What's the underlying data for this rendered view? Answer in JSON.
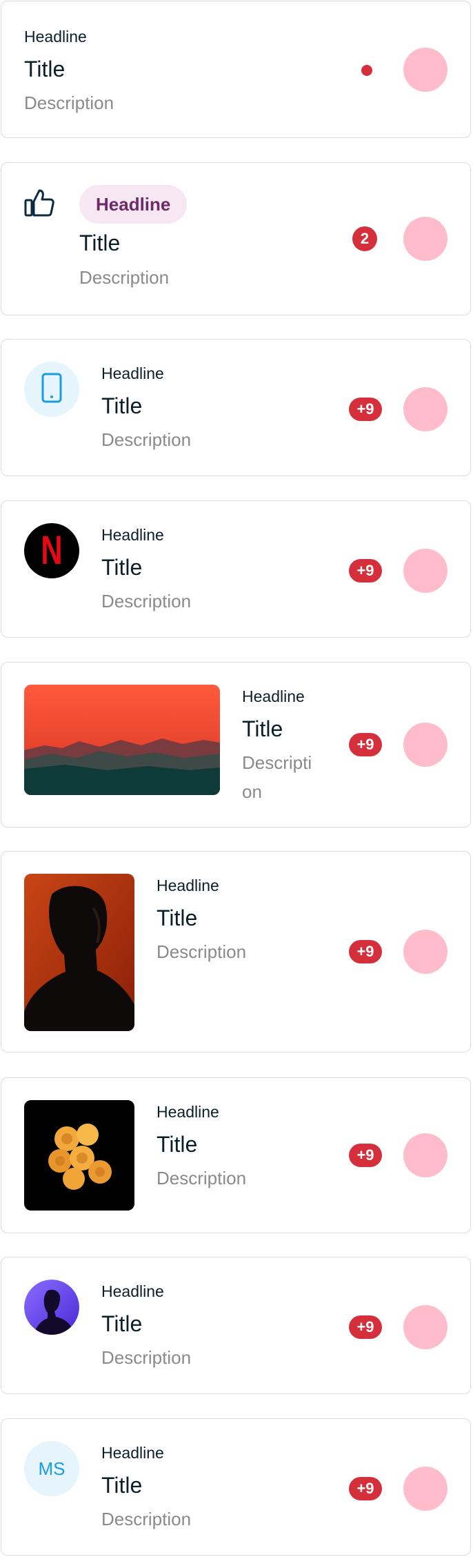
{
  "items": [
    {
      "headline": "Headline",
      "title": "Title",
      "description": "Description",
      "badge": ""
    },
    {
      "headline": "Headline",
      "title": "Title",
      "description": "Description",
      "badge": "2",
      "icon": "thumbs-up-icon"
    },
    {
      "headline": "Headline",
      "title": "Title",
      "description": "Description",
      "badge": "+9",
      "icon": "smartphone-icon"
    },
    {
      "headline": "Headline",
      "title": "Title",
      "description": "Description",
      "badge": "+9",
      "logo": "N"
    },
    {
      "headline": "Headline",
      "title": "Title",
      "description_line1": "Descripti",
      "description_line2": "on",
      "badge": "+9"
    },
    {
      "headline": "Headline",
      "title": "Title",
      "description": "Description",
      "badge": "+9"
    },
    {
      "headline": "Headline",
      "title": "Title",
      "description": "Description",
      "badge": "+9"
    },
    {
      "headline": "Headline",
      "title": "Title",
      "description": "Description",
      "badge": "+9"
    },
    {
      "headline": "Headline",
      "title": "Title",
      "description": "Description",
      "badge": "+9",
      "initials": "MS"
    }
  ],
  "colors": {
    "badge": "#d52f3c",
    "action": "#ffbdcc",
    "chip_bg": "#f6e7f2",
    "chip_text": "#6d2a6a",
    "avatar_bg": "#e6f4fc",
    "avatar_accent": "#1a9de0"
  }
}
